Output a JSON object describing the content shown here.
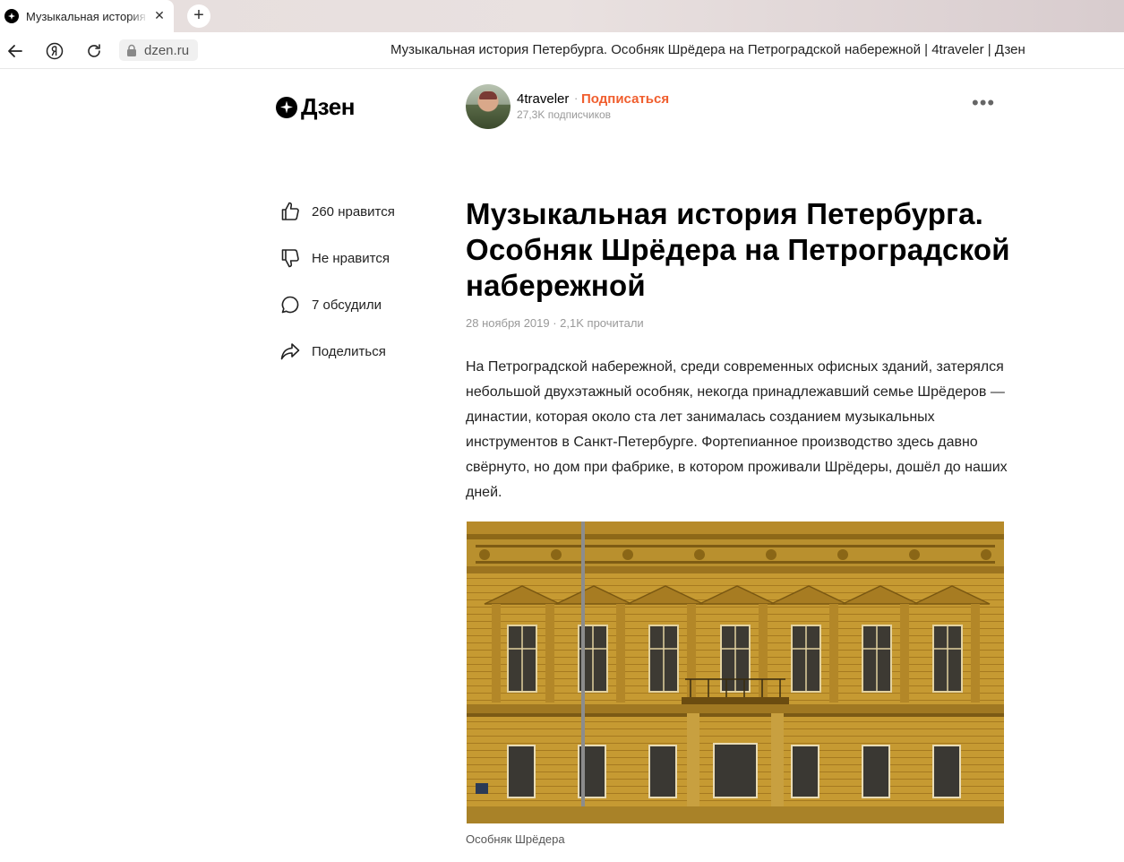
{
  "browser": {
    "tab_title": "Музыкальная история Петербурга. Особняк Шрёдера на Петроградской набережной",
    "tab_close": "✕",
    "new_tab": "+",
    "url": "dzen.ru",
    "page_heading": "Музыкальная история Петербурга. Особняк Шрёдера на Петроградской набережной | 4traveler | Дзен"
  },
  "header": {
    "logo_text": "Дзен",
    "channel_name": "4traveler",
    "separator": "·",
    "subscribe_label": "Подписаться",
    "subscribers": "27,3K подписчиков",
    "more_label": "•••"
  },
  "actions": [
    {
      "icon": "thumbs-up-icon",
      "label": "260 нравится"
    },
    {
      "icon": "thumbs-down-icon",
      "label": "Не нравится"
    },
    {
      "icon": "comment-icon",
      "label": "7 обсудили"
    },
    {
      "icon": "share-icon",
      "label": "Поделиться"
    }
  ],
  "article": {
    "title": "Музыкальная история Петербурга. Особняк Шрёдера на Петроградской набережной",
    "meta": "28 ноября 2019 · 2,1K прочитали",
    "lead": "На Петроградской набережной, среди современных офисных зданий, затерялся небольшой двухэтажный особняк, некогда принадлежавший семье Шрёдеров — династии, которая около ста лет занималась созданием музыкальных инструментов в Санкт-Петербурге. Фортепианное производство здесь давно свёрнуто, но дом при фабрике, в котором проживали Шрёдеры, дошёл до наших дней.",
    "image_caption": "Особняк Шрёдера"
  },
  "colors": {
    "accent": "#f05e2e",
    "facade": "#c4962e"
  }
}
